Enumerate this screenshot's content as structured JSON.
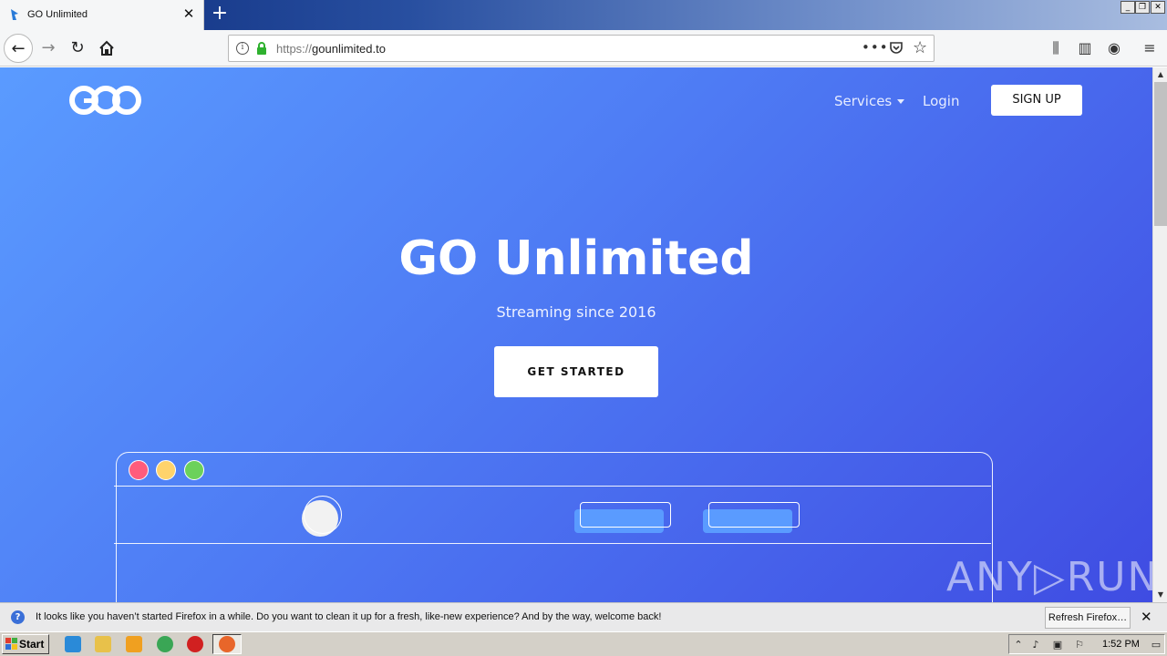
{
  "browser": {
    "tab_title": "GO Unlimited",
    "new_tab_label": "+",
    "url_scheme": "https://",
    "url_host": "gounlimited.to",
    "more_label": "•••"
  },
  "site": {
    "logo_text": "GOO",
    "nav": {
      "services_label": "Services",
      "login_label": "Login",
      "signup_label": "SIGN UP"
    },
    "hero": {
      "title": "GO Unlimited",
      "subtitle": "Streaming since 2016",
      "cta_label": "GET STARTED"
    },
    "mock_window_dots": [
      "#ff5c7c",
      "#ffd36b",
      "#6cd15a"
    ]
  },
  "watermark": "ANY▷RUN",
  "notification": {
    "message": "It looks like you haven’t started Firefox in a while. Do you want to clean it up for a fresh, like-new experience? And by the way, welcome back!",
    "button_label": "Refresh Firefox…"
  },
  "taskbar": {
    "start_label": "Start",
    "clock": "1:52 PM"
  },
  "colors": {
    "hero_gradient_start": "#5a9bff",
    "hero_gradient_end": "#3f4ce2",
    "lock_green": "#2fb12f"
  }
}
